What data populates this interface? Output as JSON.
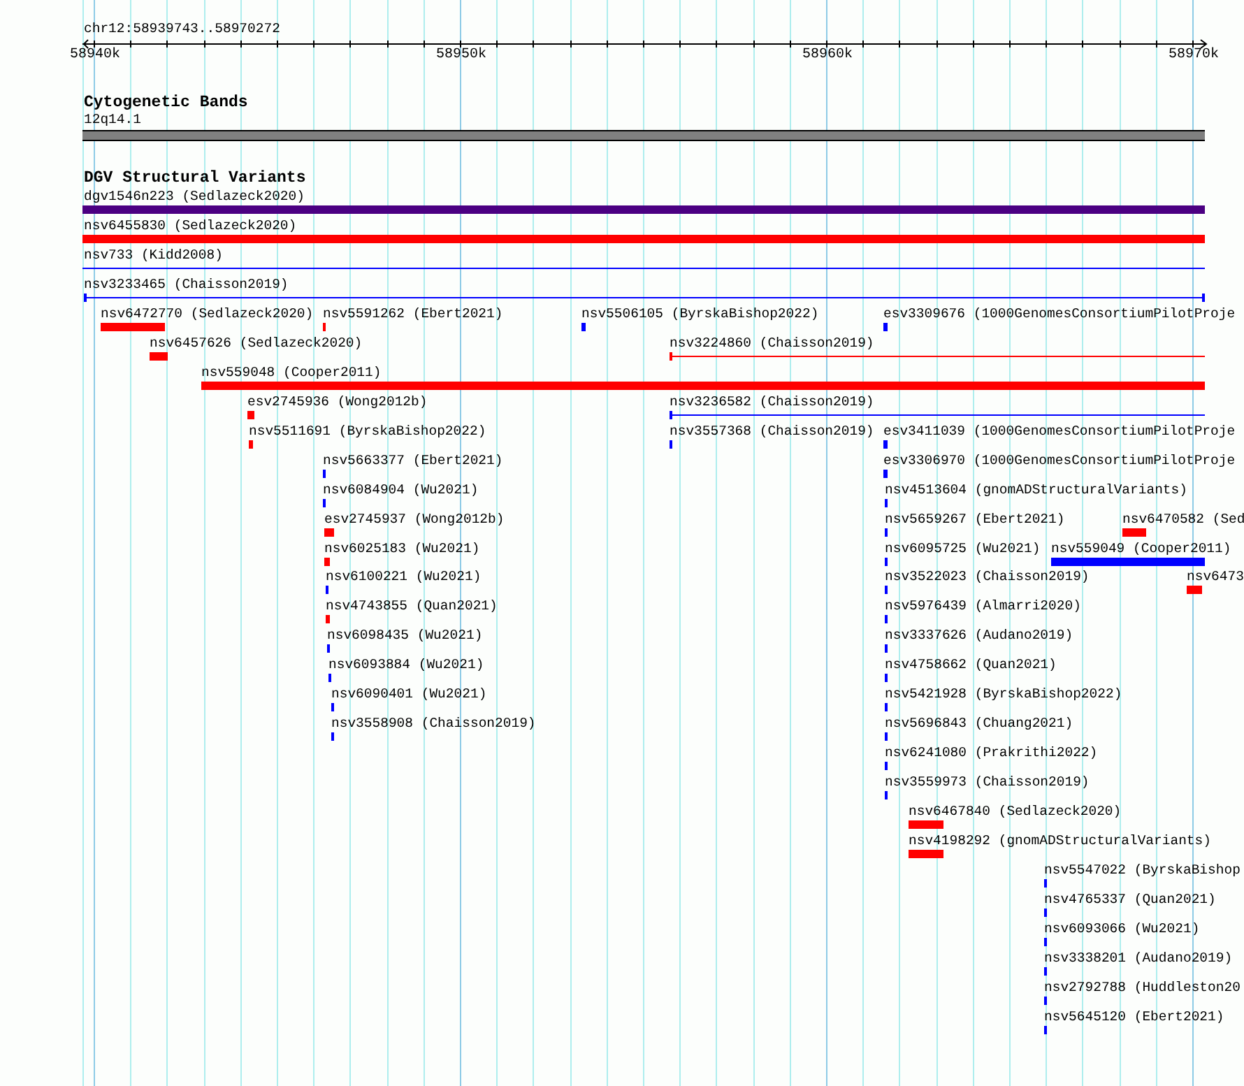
{
  "locus": "chr12:58939743..58970272",
  "ruler": {
    "labels": [
      "58940k",
      "58950k",
      "58960k",
      "58970k"
    ]
  },
  "tracks": [
    {
      "title": "Cytogenetic Bands",
      "features": [
        {
          "label": "12q14.1",
          "kind": "band"
        }
      ]
    },
    {
      "title": "DGV Structural Variants",
      "features": [
        {
          "label": "dgv1546n223 (Sedlazeck2020)",
          "kind": "bar",
          "color": "#4b0082"
        },
        {
          "label": "nsv6455830 (Sedlazeck2020)",
          "kind": "bar",
          "color": "#ff0000"
        },
        {
          "label": "nsv733 (Kidd2008)",
          "kind": "line",
          "color": "#0000ff"
        },
        {
          "label": "nsv3233465 (Chaisson2019)",
          "kind": "line",
          "color": "#0000ff"
        },
        {
          "label": "nsv6472770 (Sedlazeck2020)",
          "kind": "bar",
          "color": "#ff0000"
        },
        {
          "label": "nsv5591262 (Ebert2021)",
          "kind": "bar",
          "color": "#ff0000"
        },
        {
          "label": "nsv5506105 (ByrskaBishop2022)",
          "kind": "bar",
          "color": "#0000ff"
        },
        {
          "label": "esv3309676 (1000GenomesConsortiumPilotProje",
          "kind": "bar",
          "color": "#0000ff"
        },
        {
          "label": "nsv6457626 (Sedlazeck2020)",
          "kind": "bar",
          "color": "#ff0000"
        },
        {
          "label": "nsv3224860 (Chaisson2019)",
          "kind": "line",
          "color": "#ff0000"
        },
        {
          "label": "nsv559048 (Cooper2011)",
          "kind": "bar",
          "color": "#ff0000"
        },
        {
          "label": "esv2745936 (Wong2012b)",
          "kind": "bar",
          "color": "#ff0000"
        },
        {
          "label": "nsv3236582 (Chaisson2019)",
          "kind": "line",
          "color": "#0000ff"
        },
        {
          "label": "nsv5511691 (ByrskaBishop2022)",
          "kind": "bar",
          "color": "#ff0000"
        },
        {
          "label": "nsv3557368 (Chaisson2019)",
          "kind": "bar",
          "color": "#0000ff"
        },
        {
          "label": "esv3411039 (1000GenomesConsortiumPilotProje",
          "kind": "bar",
          "color": "#0000ff"
        },
        {
          "label": "nsv5663377 (Ebert2021)",
          "kind": "bar",
          "color": "#0000ff"
        },
        {
          "label": "esv3306970 (1000GenomesConsortiumPilotProje",
          "kind": "bar",
          "color": "#0000ff"
        },
        {
          "label": "nsv6084904 (Wu2021)",
          "kind": "bar",
          "color": "#0000ff"
        },
        {
          "label": "nsv4513604 (gnomADStructuralVariants)",
          "kind": "bar",
          "color": "#0000ff"
        },
        {
          "label": "esv2745937 (Wong2012b)",
          "kind": "bar",
          "color": "#ff0000"
        },
        {
          "label": "nsv5659267 (Ebert2021)",
          "kind": "bar",
          "color": "#0000ff"
        },
        {
          "label": "nsv6470582 (Sed",
          "kind": "bar",
          "color": "#ff0000"
        },
        {
          "label": "nsv6025183 (Wu2021)",
          "kind": "bar",
          "color": "#ff0000"
        },
        {
          "label": "nsv6095725 (Wu2021)",
          "kind": "bar",
          "color": "#0000ff"
        },
        {
          "label": "nsv559049 (Cooper2011)",
          "kind": "bar",
          "color": "#0000ff"
        },
        {
          "label": "nsv6100221 (Wu2021)",
          "kind": "bar",
          "color": "#0000ff"
        },
        {
          "label": "nsv3522023 (Chaisson2019)",
          "kind": "bar",
          "color": "#0000ff"
        },
        {
          "label": "nsv6473",
          "kind": "bar",
          "color": "#ff0000"
        },
        {
          "label": "nsv4743855 (Quan2021)",
          "kind": "bar",
          "color": "#ff0000"
        },
        {
          "label": "nsv5976439 (Almarri2020)",
          "kind": "bar",
          "color": "#0000ff"
        },
        {
          "label": "nsv6098435 (Wu2021)",
          "kind": "bar",
          "color": "#0000ff"
        },
        {
          "label": "nsv3337626 (Audano2019)",
          "kind": "bar",
          "color": "#0000ff"
        },
        {
          "label": "nsv6093884 (Wu2021)",
          "kind": "bar",
          "color": "#0000ff"
        },
        {
          "label": "nsv4758662 (Quan2021)",
          "kind": "bar",
          "color": "#0000ff"
        },
        {
          "label": "nsv6090401 (Wu2021)",
          "kind": "bar",
          "color": "#0000ff"
        },
        {
          "label": "nsv5421928 (ByrskaBishop2022)",
          "kind": "bar",
          "color": "#0000ff"
        },
        {
          "label": "nsv3558908 (Chaisson2019)",
          "kind": "bar",
          "color": "#0000ff"
        },
        {
          "label": "nsv5696843 (Chuang2021)",
          "kind": "bar",
          "color": "#0000ff"
        },
        {
          "label": "nsv6241080 (Prakrithi2022)",
          "kind": "bar",
          "color": "#0000ff"
        },
        {
          "label": "nsv3559973 (Chaisson2019)",
          "kind": "bar",
          "color": "#0000ff"
        },
        {
          "label": "nsv6467840 (Sedlazeck2020)",
          "kind": "bar",
          "color": "#ff0000"
        },
        {
          "label": "nsv4198292 (gnomADStructuralVariants)",
          "kind": "bar",
          "color": "#ff0000"
        },
        {
          "label": "nsv5547022 (ByrskaBishop",
          "kind": "bar",
          "color": "#0000ff"
        },
        {
          "label": "nsv4765337 (Quan2021)",
          "kind": "bar",
          "color": "#0000ff"
        },
        {
          "label": "nsv6093066 (Wu2021)",
          "kind": "bar",
          "color": "#0000ff"
        },
        {
          "label": "nsv3338201 (Audano2019)",
          "kind": "bar",
          "color": "#0000ff"
        },
        {
          "label": "nsv2792788 (Huddleston20",
          "kind": "bar",
          "color": "#0000ff"
        },
        {
          "label": "nsv5645120 (Ebert2021)",
          "kind": "bar",
          "color": "#0000ff"
        }
      ]
    }
  ]
}
